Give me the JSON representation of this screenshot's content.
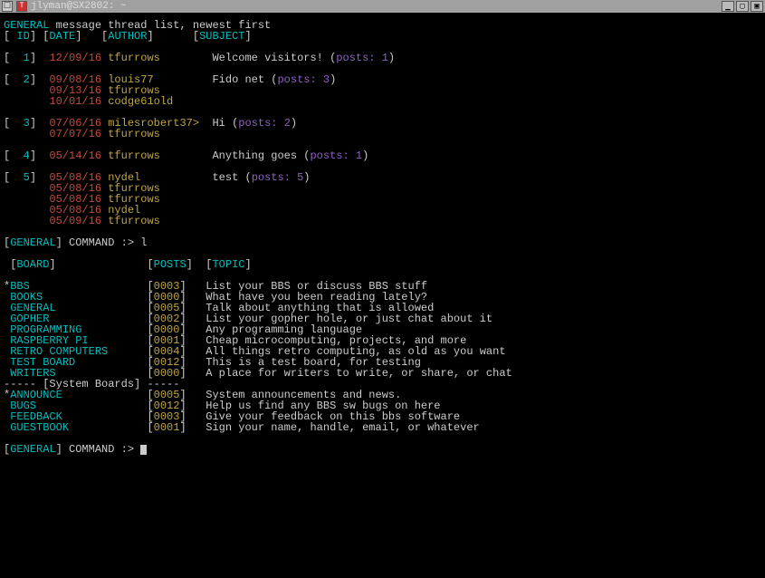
{
  "window": {
    "title": "jlyman@SX2802: ~"
  },
  "header": {
    "board": "GENERAL",
    "subtitle": "message thread list, newest first",
    "cols": {
      "id": "ID",
      "date": "DATE",
      "author": "AUTHOR",
      "subject": "SUBJECT"
    }
  },
  "threads": [
    {
      "id": "1",
      "rows": [
        {
          "date": "12/09/16",
          "author": "tfurrows",
          "subject": "Welcome visitors!",
          "posts": "1"
        }
      ]
    },
    {
      "id": "2",
      "rows": [
        {
          "date": "09/08/16",
          "author": "louis77",
          "subject": "Fido net",
          "posts": "3"
        },
        {
          "date": "09/13/16",
          "author": "tfurrows"
        },
        {
          "date": "10/01/16",
          "author": "codge61old"
        }
      ]
    },
    {
      "id": "3",
      "rows": [
        {
          "date": "07/06/16",
          "author": "milesrobert37>",
          "subject": "Hi",
          "posts": "2"
        },
        {
          "date": "07/07/16",
          "author": "tfurrows"
        }
      ]
    },
    {
      "id": "4",
      "rows": [
        {
          "date": "05/14/16",
          "author": "tfurrows",
          "subject": "Anything goes",
          "posts": "1"
        }
      ]
    },
    {
      "id": "5",
      "rows": [
        {
          "date": "05/08/16",
          "author": "nydel",
          "subject": "test",
          "posts": "5"
        },
        {
          "date": "05/08/16",
          "author": "tfurrows"
        },
        {
          "date": "05/08/16",
          "author": "tfurrows"
        },
        {
          "date": "05/08/16",
          "author": "nydel"
        },
        {
          "date": "05/09/16",
          "author": "tfurrows"
        }
      ]
    }
  ],
  "command1": {
    "prompt": "GENERAL",
    "label": "COMMAND :>",
    "input": "l"
  },
  "boardHeader": {
    "board": "BOARD",
    "posts": "POSTS",
    "topic": "TOPIC"
  },
  "boards": [
    {
      "name": "BBS",
      "posts": "0003",
      "topic": "List your BBS or discuss BBS stuff",
      "star": true
    },
    {
      "name": "BOOKS",
      "posts": "0000",
      "topic": "What have you been reading lately?"
    },
    {
      "name": "GENERAL",
      "posts": "0005",
      "topic": "Talk about anything that is allowed"
    },
    {
      "name": "GOPHER",
      "posts": "0002",
      "topic": "List your gopher hole, or just chat about it"
    },
    {
      "name": "PROGRAMMING",
      "posts": "0000",
      "topic": "Any programming language"
    },
    {
      "name": "RASPBERRY PI",
      "posts": "0001",
      "topic": "Cheap microcomputing, projects, and more"
    },
    {
      "name": "RETRO COMPUTERS",
      "posts": "0004",
      "topic": "All things retro computing, as old as you want"
    },
    {
      "name": "TEST BOARD",
      "posts": "0012",
      "topic": "This is a test board, for testing"
    },
    {
      "name": "WRITERS",
      "posts": "0000",
      "topic": "A place for writers to write, or share, or chat"
    }
  ],
  "systemBoardsLabel": "[System Boards]",
  "systemBoards": [
    {
      "name": "ANNOUNCE",
      "posts": "0005",
      "topic": "System announcements and news.",
      "star": true
    },
    {
      "name": "BUGS",
      "posts": "0012",
      "topic": "Help us find any BBS sw bugs on here"
    },
    {
      "name": "FEEDBACK",
      "posts": "0003",
      "topic": "Give your feedback on this bbs software"
    },
    {
      "name": "GUESTBOOK",
      "posts": "0001",
      "topic": "Sign your name, handle, email, or whatever"
    }
  ],
  "command2": {
    "prompt": "GENERAL",
    "label": "COMMAND :>"
  }
}
